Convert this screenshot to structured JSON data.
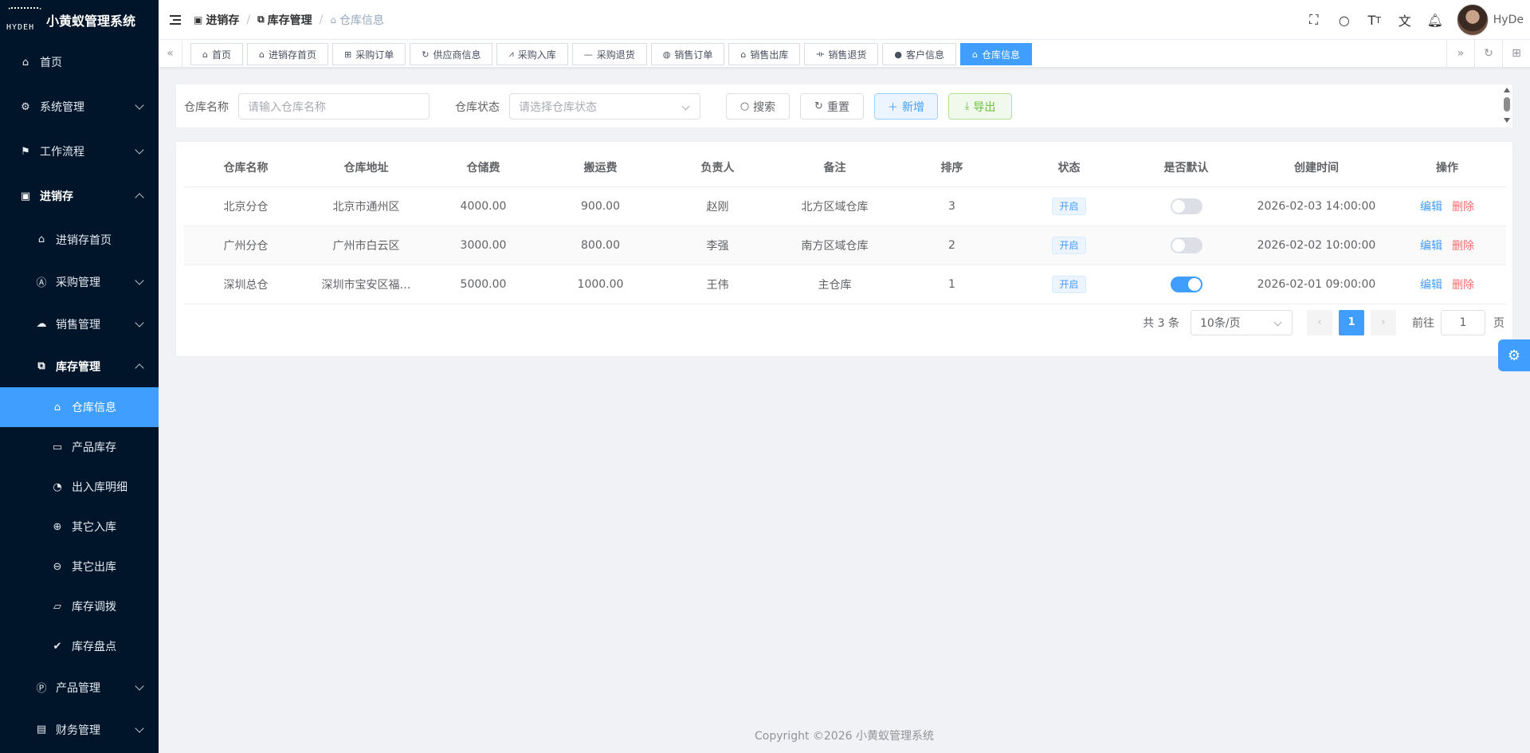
{
  "app": {
    "title": "小黄蚁管理系统",
    "logo_text": "HYDEH"
  },
  "sidebar": {
    "items": [
      {
        "label": "首页",
        "icon": "home-icon"
      },
      {
        "label": "系统管理",
        "icon": "gear-icon"
      },
      {
        "label": "工作流程",
        "icon": "workflow-icon"
      },
      {
        "label": "进销存",
        "icon": "letter-e-icon"
      }
    ],
    "jxc_children": [
      {
        "label": "进销存首页",
        "icon": "home-icon"
      },
      {
        "label": "采购管理",
        "icon": "letter-a-icon"
      },
      {
        "label": "销售管理",
        "icon": "cloud-icon"
      },
      {
        "label": "库存管理",
        "icon": "inventory-icon"
      }
    ],
    "inventory_children": [
      {
        "label": "仓库信息",
        "icon": "warehouse-icon"
      },
      {
        "label": "产品库存",
        "icon": "cup-icon"
      },
      {
        "label": "出入库明细",
        "icon": "signal-icon"
      },
      {
        "label": "其它入库",
        "icon": "zoom-in-icon"
      },
      {
        "label": "其它出库",
        "icon": "zoom-out-icon"
      },
      {
        "label": "库存调拨",
        "icon": "folder-icon"
      },
      {
        "label": "库存盘点",
        "icon": "check-circle-icon"
      }
    ],
    "bottom_items": [
      {
        "label": "产品管理",
        "icon": "letter-p-icon"
      },
      {
        "label": "财务管理",
        "icon": "finance-icon"
      }
    ]
  },
  "header": {
    "breadcrumb": [
      "进销存",
      "库存管理",
      "仓库信息"
    ],
    "user_name": "HyDe"
  },
  "tags": [
    {
      "label": "首页",
      "icon": "home-icon"
    },
    {
      "label": "进销存首页",
      "icon": "home-icon"
    },
    {
      "label": "采购订单",
      "icon": "grid-icon"
    },
    {
      "label": "供应商信息",
      "icon": "refresh-icon"
    },
    {
      "label": "采购入库",
      "icon": "road-icon"
    },
    {
      "label": "采购退货",
      "icon": "minus-icon"
    },
    {
      "label": "销售订单",
      "icon": "globe-icon"
    },
    {
      "label": "销售出库",
      "icon": "bag-icon"
    },
    {
      "label": "销售退货",
      "icon": "dumbbell-icon"
    },
    {
      "label": "客户信息",
      "icon": "user-icon"
    },
    {
      "label": "仓库信息",
      "icon": "warehouse-icon",
      "active": true
    }
  ],
  "search": {
    "name_label": "仓库名称",
    "name_placeholder": "请输入仓库名称",
    "status_label": "仓库状态",
    "status_placeholder": "请选择仓库状态",
    "search_btn": "搜索",
    "reset_btn": "重置",
    "add_btn": "新增",
    "export_btn": "导出"
  },
  "table": {
    "columns": [
      "仓库名称",
      "仓库地址",
      "仓储费",
      "搬运费",
      "负责人",
      "备注",
      "排序",
      "状态",
      "是否默认",
      "创建时间",
      "操作"
    ],
    "rows": [
      {
        "name": "北京分仓",
        "address": "北京市通州区",
        "storage_fee": "4000.00",
        "handling_fee": "900.00",
        "manager": "赵刚",
        "remark": "北方区域仓库",
        "sort": "3",
        "status": "开启",
        "is_default": false,
        "created": "2026-02-03 14:00:00"
      },
      {
        "name": "广州分仓",
        "address": "广州市白云区",
        "storage_fee": "3000.00",
        "handling_fee": "800.00",
        "manager": "李强",
        "remark": "南方区域仓库",
        "sort": "2",
        "status": "开启",
        "is_default": false,
        "created": "2026-02-02 10:00:00"
      },
      {
        "name": "深圳总仓",
        "address": "深圳市宝安区福…",
        "storage_fee": "5000.00",
        "handling_fee": "1000.00",
        "manager": "王伟",
        "remark": "主仓库",
        "sort": "1",
        "status": "开启",
        "is_default": true,
        "created": "2026-02-01 09:00:00"
      }
    ],
    "edit_label": "编辑",
    "delete_label": "删除"
  },
  "pagination": {
    "total": "共 3 条",
    "page_size": "10条/页",
    "current": "1",
    "goto_label": "前往",
    "goto_value": "1",
    "page_unit": "页"
  },
  "footer": {
    "text": "Copyright ©2026 小黄蚁管理系统"
  }
}
